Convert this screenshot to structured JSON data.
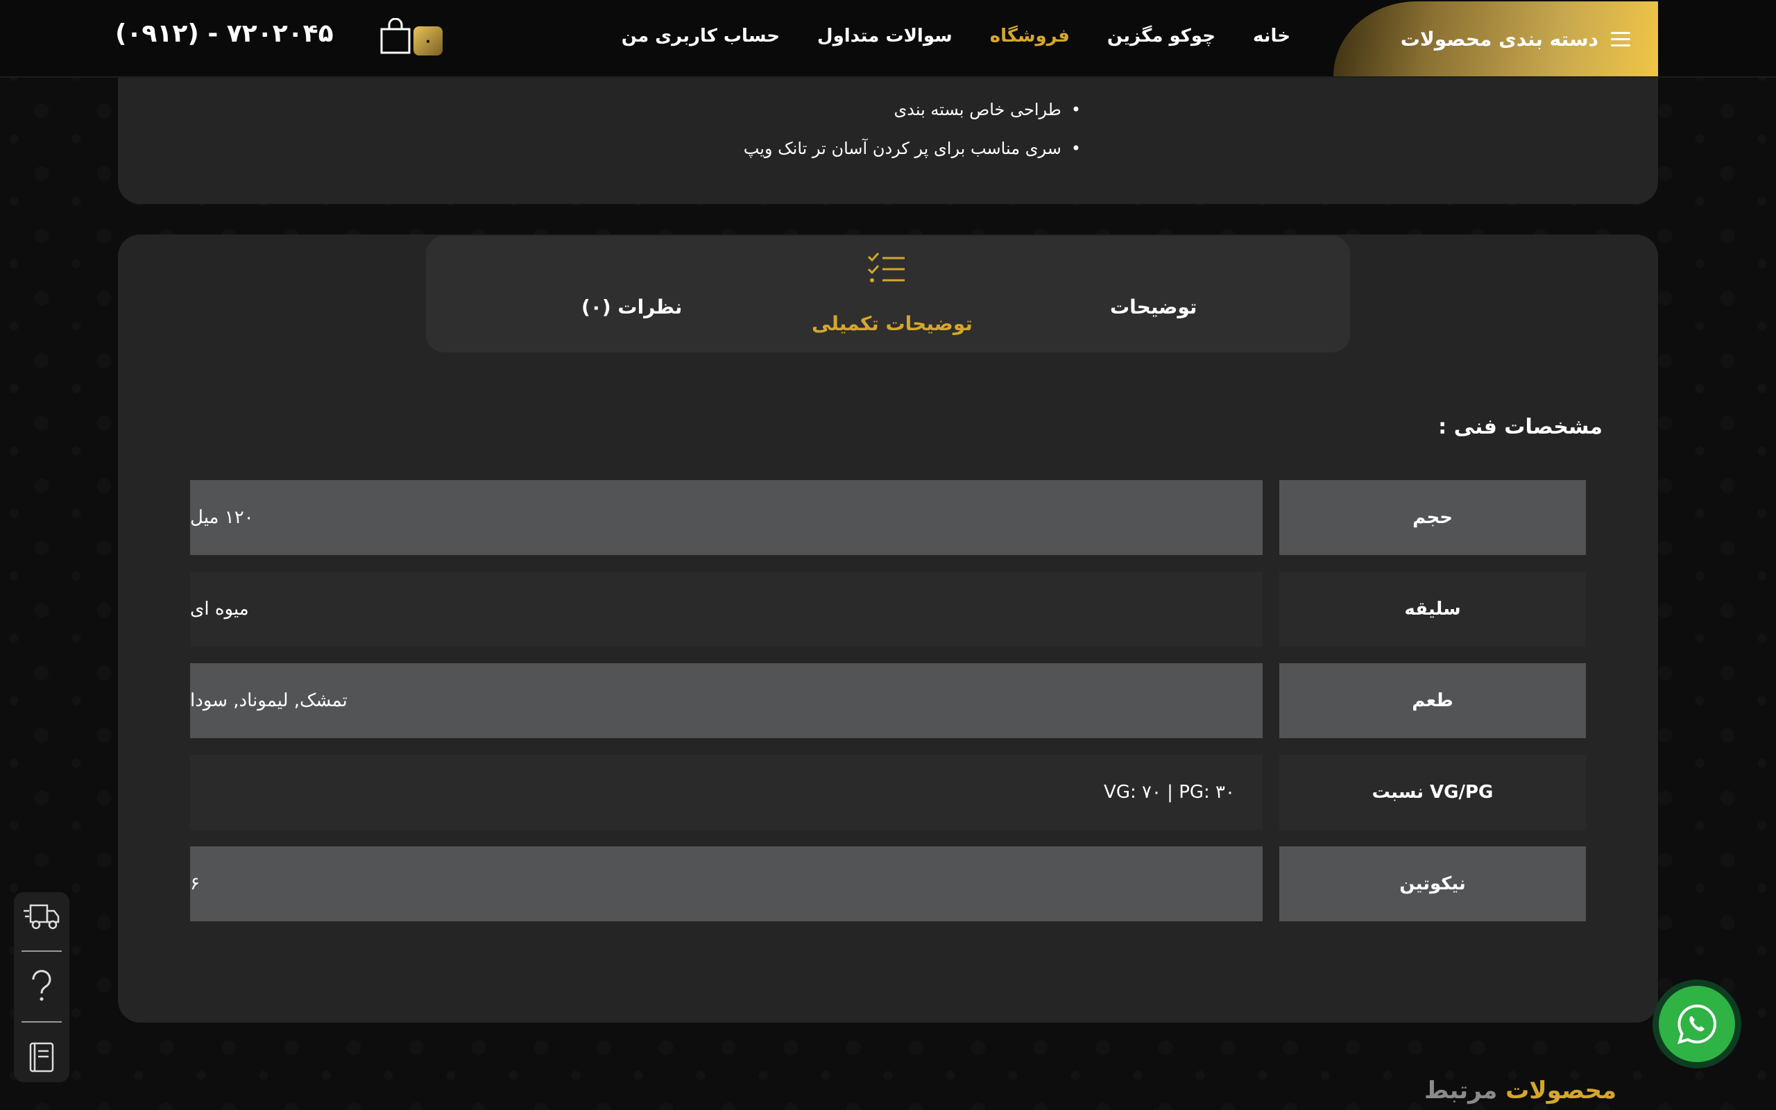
{
  "header": {
    "categories_label": "دسته بندی محصولات",
    "nav": [
      {
        "label": "خانه",
        "active": false
      },
      {
        "label": "چوکو مگزین",
        "active": false
      },
      {
        "label": "فروشگاه",
        "active": true
      },
      {
        "label": "سوالات متداول",
        "active": false
      },
      {
        "label": "حساب کاربری من",
        "active": false
      }
    ],
    "cart_count": "۰",
    "phone": "(۰۹۱۲) - ۷۲۰۲۰۴۵"
  },
  "features": [
    "طراحی خاص بسته بندی",
    "سری مناسب برای پر کردن آسان تر تانک ویپ"
  ],
  "tabs": {
    "description": "توضیحات",
    "additional": "توضیحات تکمیلی",
    "reviews": "نظرات (۰)"
  },
  "specs": {
    "title": "مشخصات فنی :",
    "rows": [
      {
        "label": "حجم",
        "value": "۱۲۰ میل"
      },
      {
        "label": "سلیقه",
        "value": "میوه ای"
      },
      {
        "label": "طعم",
        "value": "تمشک, لیموناد, سودا"
      },
      {
        "label": "نسبت VG/PG",
        "value": "VG: ۷۰ | PG: ۳۰"
      },
      {
        "label": "نیکوتین",
        "value": "۶"
      }
    ]
  },
  "related": {
    "gold": "محصولات",
    "gray": "مرتبط"
  },
  "colors": {
    "accent": "#d4a72c",
    "whatsapp": "#2fb344"
  }
}
